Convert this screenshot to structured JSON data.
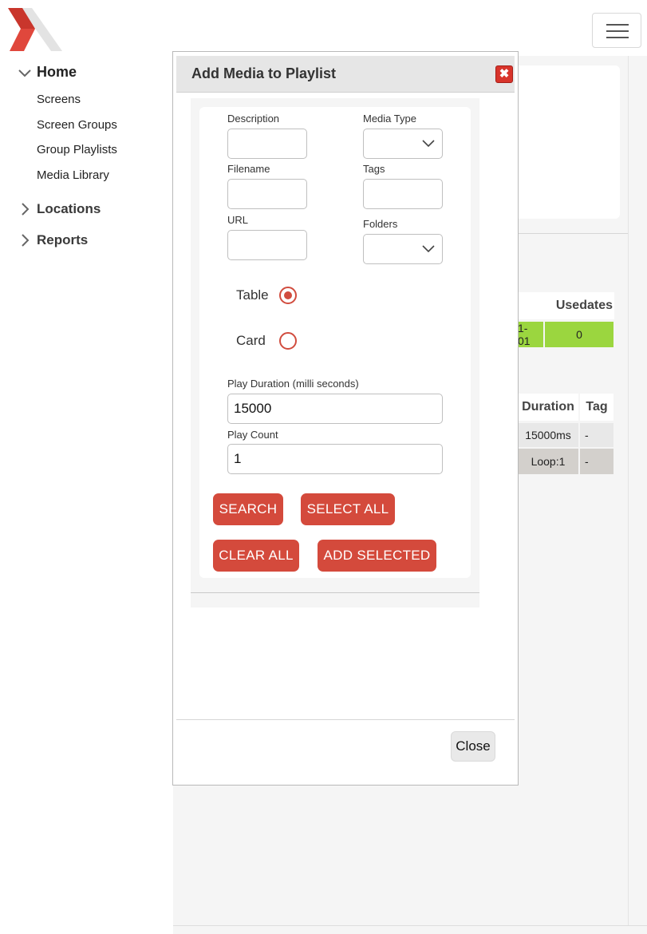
{
  "app": {
    "logo_name": "X logo"
  },
  "sidebar": {
    "home_label": "Home",
    "items": [
      {
        "label": "Screens"
      },
      {
        "label": "Screen Groups"
      },
      {
        "label": "Group Playlists"
      },
      {
        "label": "Media Library"
      }
    ],
    "locations_label": "Locations",
    "reports_label": "Reports"
  },
  "background_page": {
    "table1": {
      "header": "Usedates",
      "date_fragment": "1-01",
      "value": "0",
      "value_color": "#9bd63f"
    },
    "table2": {
      "headers": [
        "Duration",
        "Tag"
      ],
      "rows": [
        {
          "duration": "15000ms",
          "tag": "-"
        },
        {
          "duration": "Loop:1",
          "tag": "-"
        }
      ]
    }
  },
  "modal": {
    "title": "Add Media to Playlist",
    "fields": {
      "description": {
        "label": "Description",
        "value": ""
      },
      "media_type": {
        "label": "Media Type",
        "value": ""
      },
      "filename": {
        "label": "Filename",
        "value": ""
      },
      "tags": {
        "label": "Tags",
        "value": ""
      },
      "url": {
        "label": "URL",
        "value": ""
      },
      "folders": {
        "label": "Folders",
        "value": ""
      }
    },
    "view_mode": {
      "options": [
        "Table",
        "Card"
      ],
      "selected": "Table"
    },
    "play_duration": {
      "label": "Play Duration (milli seconds)",
      "value": "15000"
    },
    "play_count": {
      "label": "Play Count",
      "value": "1"
    },
    "buttons": {
      "search": "SEARCH",
      "select_all": "SELECT ALL",
      "clear_all": "CLEAR ALL",
      "add_selected": "ADD SELECTED"
    },
    "close_label": "Close",
    "accent_color": "#d44a3c"
  }
}
